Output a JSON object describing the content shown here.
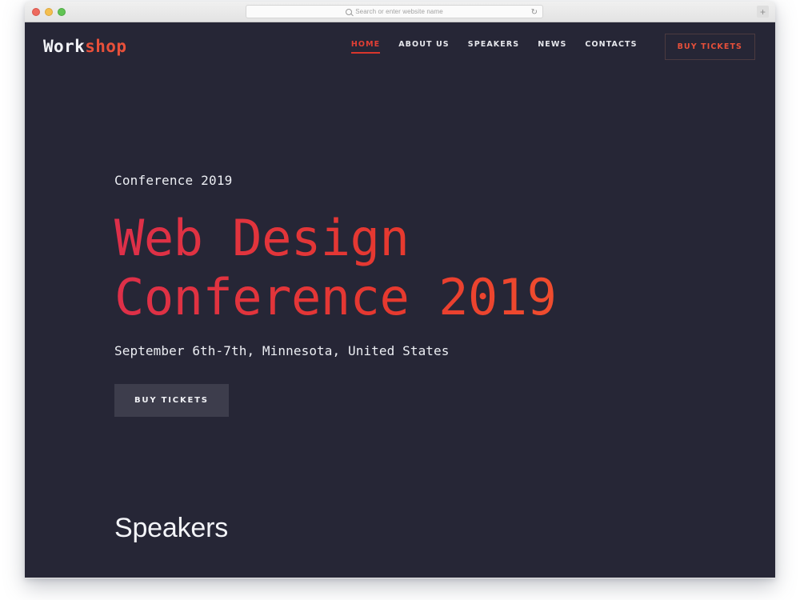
{
  "browser": {
    "traffic_lights": [
      "close",
      "minimize",
      "maximize"
    ],
    "address_placeholder": "Search or enter website name",
    "address_value": "",
    "reload_icon": "↻",
    "new_tab_icon": "+",
    "search_icon": "search-icon"
  },
  "site": {
    "logo": {
      "part_one": "Work",
      "part_two": "shop",
      "color_one": "#f2f3f7",
      "color_two": "#e8503a"
    },
    "nav": {
      "items": [
        {
          "label": "HOME",
          "active": true
        },
        {
          "label": "ABOUT US",
          "active": false
        },
        {
          "label": "SPEAKERS",
          "active": false
        },
        {
          "label": "NEWS",
          "active": false
        },
        {
          "label": "CONTACTS",
          "active": false
        }
      ],
      "cta_label": "BUY TICKETS"
    },
    "hero": {
      "eyebrow": "Conference 2019",
      "title_line_1": "Web Design",
      "title_line_2": "Conference 2019",
      "subtitle": "September 6th-7th, Minnesota, United States",
      "cta_label": "BUY TICKETS"
    },
    "speakers": {
      "title": "Speakers"
    },
    "colors": {
      "background": "#262636",
      "accent_red": "#e33f35",
      "accent_orange": "#f4552e",
      "gradient_start": "#dd2f4a",
      "gradient_end": "#f76a33",
      "text_light": "#eceef3",
      "button_grey": "#3d3d4c"
    }
  }
}
